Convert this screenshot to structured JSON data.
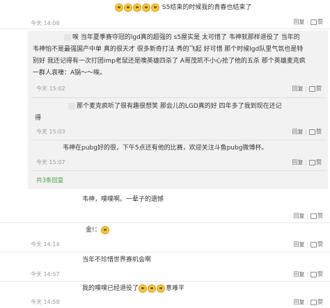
{
  "top_comment": {
    "text": "S5结束的时候我的青春也结束了",
    "time": "今天 14:08",
    "reply": "回复",
    "like": "赞"
  },
  "main_comment": {
    "lines": [
      "唉 当年夏季赛夺冠的lgd真的超强的 s5屋实是 太可惜了 韦神就那样退役了 当年的",
      "韦神怕不是最强国产中单 真的很天才 很多新奇打法 秀的飞起 好可惜 那个时候lgd队里气氛也是特",
      "别好 我还记得有一次打团imp老鼠还是噢英雄四杀了 A哥茂凯不小心抢了他的五杀 那个英雄麦克疯",
      "一群人哀嚎：A锅～～唉。"
    ],
    "time": "今天 15:02",
    "reply": "回复",
    "like": "赞"
  },
  "sub_replies": [
    {
      "lines": [
        "那个麦克疯听了很有趣很想笑 那会儿的LGD真的好 四年多了我到现在还记",
        "得"
      ],
      "time": "今天 15:03",
      "reply": "回复",
      "like": "赞"
    },
    {
      "lines": [
        "韦神在pubg好的很，下午5点还有他的比赛，欢迎关注斗鱼pubg微博杯。"
      ],
      "time": "今天 15:07",
      "reply": "回复",
      "like": "赞"
    }
  ],
  "more_replies": "共3条回复",
  "comments": [
    {
      "text": "韦神，噗噗啊。一辈子的遗憾",
      "time": "",
      "reply": "回复",
      "like": "赞"
    },
    {
      "text": "金!：",
      "time": "今天 14:14",
      "reply": "回复",
      "like": "赞"
    },
    {
      "text": "当年不珍惜世界赛机会啊",
      "time": "今天 14:57",
      "reply": "回复",
      "like": "赞"
    },
    {
      "text_before": "我的噗噗已经退役了",
      "text_after": "意难平",
      "time": "今天 14:58",
      "reply": "回复",
      "like": "赞"
    }
  ]
}
